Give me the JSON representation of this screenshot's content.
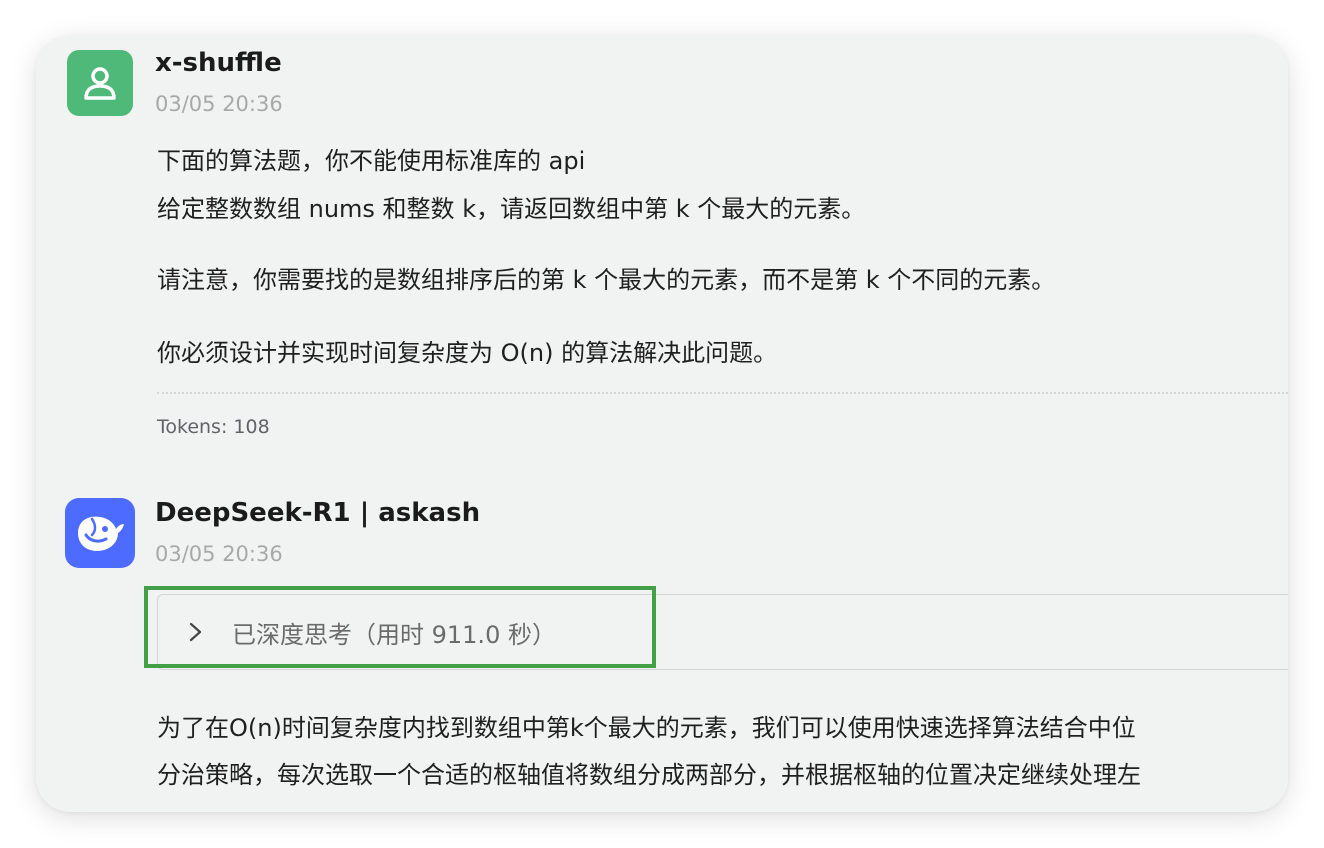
{
  "messages": {
    "user": {
      "name": "x-shuffle",
      "time": "03/05 20:36",
      "avatar_icon": "person-icon",
      "avatar_color": "#4fb979",
      "lines": [
        "下面的算法题，你不能使用标准库的 api",
        "给定整数数组 nums 和整数 k，请返回数组中第 k 个最大的元素。",
        "请注意，你需要找的是数组排序后的第 k 个最大的元素，而不是第 k 个不同的元素。",
        "你必须设计并实现时间复杂度为 O(n) 的算法解决此问题。"
      ],
      "tokens": "Tokens: 108"
    },
    "assistant": {
      "name": "DeepSeek-R1 | askash",
      "time": "03/05 20:36",
      "avatar_icon": "deepseek-whale-icon",
      "avatar_color": "#4d6bfe",
      "thinking_label": "已深度思考（用时 911.0 秒）",
      "thinking_icon": "chevron-right-icon",
      "lines": [
        "为了在O(n)时间复杂度内找到数组中第k个最大的元素，我们可以使用快速选择算法结合中位",
        "分治策略，每次选取一个合适的枢轴值将数组分成两部分，并根据枢轴的位置决定继续处理左"
      ]
    }
  },
  "highlight_color": "#43a047"
}
